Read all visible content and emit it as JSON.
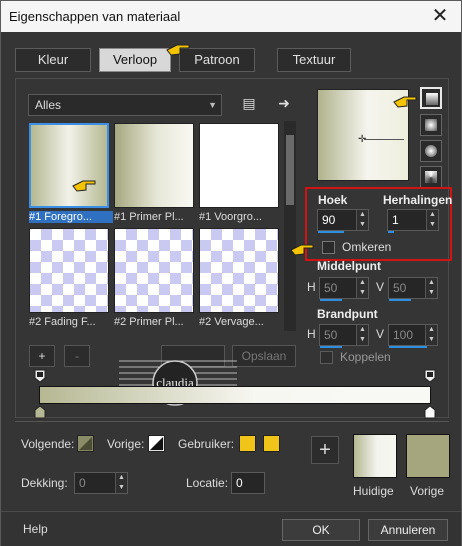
{
  "window": {
    "title": "Eigenschappen van materiaal",
    "close_glyph": "✕"
  },
  "tabs": [
    {
      "label": "Kleur"
    },
    {
      "label": "Verloop"
    },
    {
      "label": "Patroon"
    },
    {
      "label": "Textuur"
    }
  ],
  "library": {
    "category": "Alles",
    "items": [
      {
        "label": "#1 Foregro..."
      },
      {
        "label": "#1 Primer Pl..."
      },
      {
        "label": "#1 Voorgro..."
      },
      {
        "label": "#2 Fading F..."
      },
      {
        "label": "#2 Primer Pl..."
      },
      {
        "label": "#2 Vervage..."
      }
    ],
    "add_label": "+",
    "remove_label": "-",
    "save_label": "Opslaan"
  },
  "gradient": {
    "angle_label": "Hoek",
    "angle_value": "90",
    "repeat_label": "Herhalingen",
    "repeat_value": "1",
    "invert_label": "Omkeren",
    "center_label": "Middelpunt",
    "center_h_label": "H",
    "center_h": "50",
    "center_v_label": "V",
    "center_v": "50",
    "focal_label": "Brandpunt",
    "focal_h_label": "H",
    "focal_h": "50",
    "focal_v_label": "V",
    "focal_v": "100",
    "link_label": "Koppelen"
  },
  "stops": {
    "next_label": "Volgende:",
    "prev_label": "Vorige:",
    "user_label": "Gebruiker:",
    "opacity_label": "Dekking:",
    "opacity_value": "0",
    "location_label": "Locatie:",
    "location_value": "0"
  },
  "swatches": {
    "add_glyph": "+",
    "current_label": "Huidige",
    "previous_label": "Vorige"
  },
  "watermark": {
    "text": "claudia"
  },
  "footer": {
    "help_label": "Help",
    "ok_label": "OK",
    "cancel_label": "Annuleren"
  },
  "colors": {
    "accent": "#2f70c0",
    "highlight": "#d01414",
    "swatch_user": "#f0c419",
    "foreground": "#b5b892"
  }
}
